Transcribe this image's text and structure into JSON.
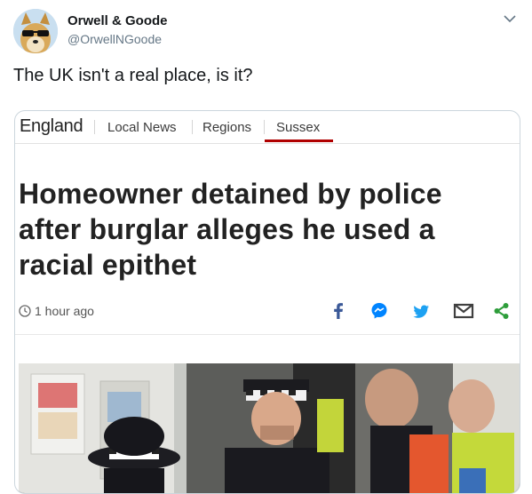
{
  "tweet": {
    "display_name": "Orwell & Goode",
    "handle": "@OrwellNGoode",
    "text": "The UK isn't a real place, is it?"
  },
  "card": {
    "nav": {
      "section": "England",
      "links": [
        "Local News",
        "Regions",
        "Sussex"
      ],
      "active": "Sussex",
      "accent_color": "#b00000"
    },
    "headline_lines": [
      "Homeowner detained by police",
      "after burglar alleges he used a",
      "racial epithet"
    ],
    "timestamp": "1 hour ago",
    "share_icons": [
      "facebook-icon",
      "messenger-icon",
      "twitter-icon",
      "email-icon",
      "share-icon"
    ],
    "colors": {
      "facebook": "#3b5998",
      "messenger": "#0084ff",
      "twitter": "#1da1f2",
      "email": "#404040",
      "share": "#2d9d3a"
    }
  }
}
